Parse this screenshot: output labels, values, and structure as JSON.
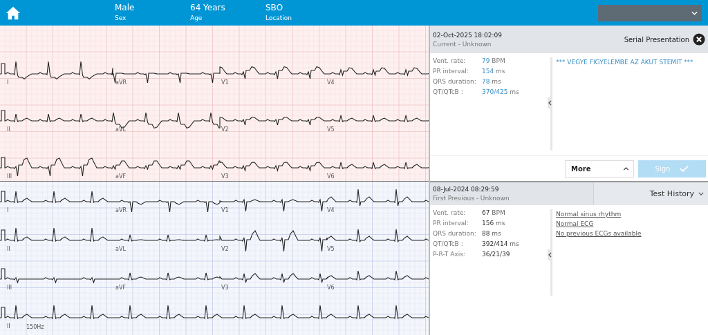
{
  "header": {
    "fields": [
      {
        "value": "Male",
        "label": "Sex"
      },
      {
        "value": "64 Years",
        "label": "Age"
      },
      {
        "value": "SBO",
        "label": "Location"
      }
    ]
  },
  "ecg_panels": [
    {
      "kind": "current",
      "rows": [
        [
          "I",
          "aVR",
          "V1",
          "V4"
        ],
        [
          "II",
          "aVL",
          "V2",
          "V5"
        ],
        [
          "III",
          "aVF",
          "V3",
          "V6"
        ]
      ]
    },
    {
      "kind": "previous",
      "rows": [
        [
          "I",
          "aVR",
          "V1",
          "V4"
        ],
        [
          "II",
          "aVL",
          "V2",
          "V5"
        ],
        [
          "III",
          "aVF",
          "V3",
          "V6"
        ],
        [
          "II"
        ]
      ],
      "filter": "150Hz"
    }
  ],
  "reports": [
    {
      "kind": "current",
      "datetime": "02-Oct-2025 18:02:09",
      "subtitle": "Current - Unknown",
      "action": "Serial Presentation",
      "measurements": [
        {
          "label": "Vent. rate:",
          "value": "79",
          "unit": "BPM"
        },
        {
          "label": "PR interval:",
          "value": "154",
          "unit": "ms"
        },
        {
          "label": "QRS duration:",
          "value": "78",
          "unit": "ms"
        },
        {
          "label": "QT/QTcB :",
          "value": "370/425",
          "unit": "ms"
        }
      ],
      "statements": [
        "*** VEGYE FIGYELEMBE AZ AKUT STEMIT ***"
      ],
      "footer": {
        "more": "More",
        "sign": "Sign",
        "sign_disabled": true
      }
    },
    {
      "kind": "previous",
      "datetime": "08-Jul-2024 08:29:59",
      "subtitle": "First Previous - Unknown",
      "action": "Test History",
      "measurements": [
        {
          "label": "Vent. rate:",
          "value": "67",
          "unit": "BPM"
        },
        {
          "label": "PR interval:",
          "value": "156",
          "unit": "ms"
        },
        {
          "label": "QRS duration:",
          "value": "88",
          "unit": "ms"
        },
        {
          "label": "QT/QTcB :",
          "value": "392/414",
          "unit": "ms"
        },
        {
          "label": "P-R-T Axis:",
          "value": "36/21/39"
        }
      ],
      "statements": [
        "Normal sinus rhythm",
        "Normal ECG",
        "No previous ECGs available"
      ]
    }
  ]
}
